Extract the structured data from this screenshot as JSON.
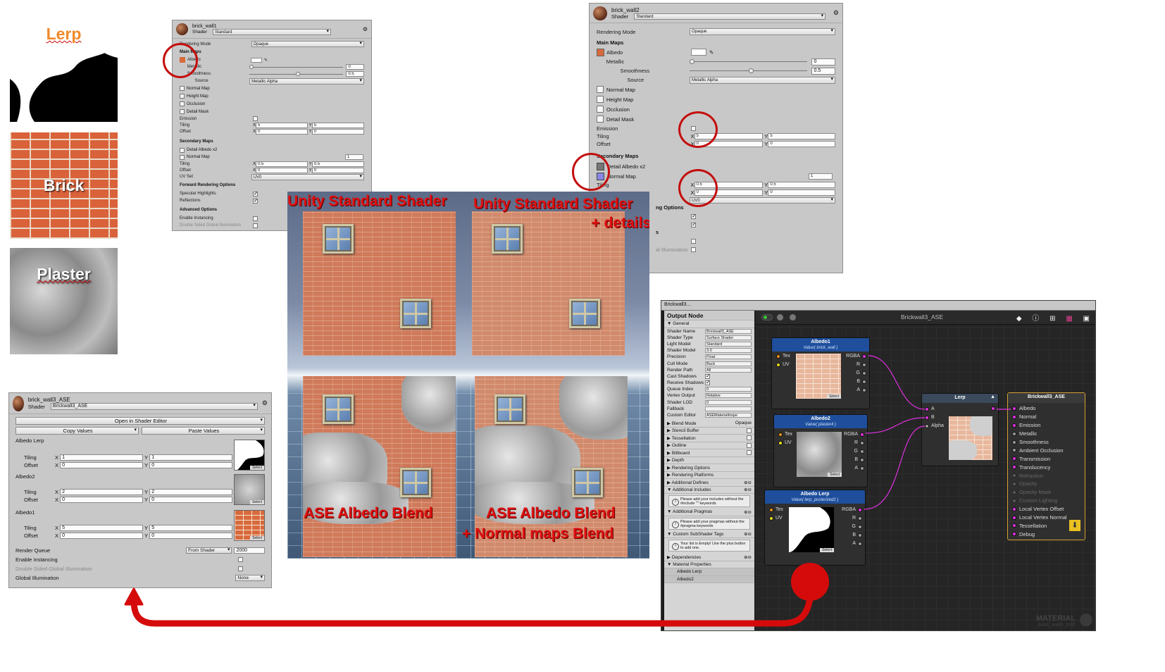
{
  "swatches": {
    "lerp": "Lerp",
    "brick": "Brick",
    "plaster": "Plaster"
  },
  "inspector1": {
    "material": "brick_wall1",
    "shader_label": "Shader",
    "shader": "Standard",
    "rendering_mode_label": "Rendering Mode",
    "rendering_mode": "Opaque",
    "main_maps": "Main Maps",
    "albedo": "Albedo",
    "metallic": "Metallic",
    "metallic_value": "0",
    "smoothness": "Smoothness",
    "smoothness_value": "0.5",
    "source": "Source",
    "source_value": "Metallic Alpha",
    "normal_map": "Normal Map",
    "height_map": "Height Map",
    "occlusion": "Occlusion",
    "detail_mask": "Detail Mask",
    "emission": "Emission",
    "tiling": "Tiling",
    "offset": "Offset",
    "tiling_x": "5",
    "tiling_y": "5",
    "offset_x": "0",
    "offset_y": "0",
    "secondary_maps": "Secondary Maps",
    "detail_albedo": "Detail Albedo x2",
    "normal_map2": "Normal Map",
    "normal_scale": "1",
    "tiling2_x": "0.5",
    "tiling2_y": "0.5",
    "offset2_x": "0",
    "offset2_y": "0",
    "uv_set": "UV Set",
    "uv_value": "UV0",
    "forward": "Forward Rendering Options",
    "specular": "Specular Highlights",
    "reflections": "Reflections",
    "advanced": "Advanced Options",
    "instancing": "Enable Instancing",
    "double_sided": "Double Sided Global Illumination"
  },
  "inspector2": {
    "material": "brick_wall2",
    "shader_label": "Shader",
    "shader": "Standard",
    "rendering_mode_label": "Rendering Mode",
    "rendering_mode": "Opaque",
    "main_maps": "Main Maps",
    "albedo": "Albedo",
    "metallic": "Metallic",
    "metallic_value": "0",
    "smoothness": "Smoothness",
    "smoothness_value": "0.5",
    "source": "Source",
    "source_value": "Metallic Alpha",
    "normal_map": "Normal Map",
    "height_map": "Height Map",
    "occlusion": "Occlusion",
    "detail_mask": "Detail Mask",
    "emission": "Emission",
    "tiling": "Tiling",
    "offset": "Offset",
    "tiling_x": "5",
    "tiling_y": "5",
    "offset_x": "0",
    "offset_y": "0",
    "secondary_maps": "Secondary Maps",
    "detail_albedo": "Detail Albedo x2",
    "normal_map2": "Normal Map",
    "normal_scale": "1",
    "tiling2": "Tiling",
    "tiling2_x": "0.5",
    "tiling2_y": "0.5",
    "offset2_x": "0",
    "offset2_y": "0",
    "uv_value": "UV0",
    "options_partial": "ng Options",
    "s_partial": "s",
    "gi_partial": "al Illumination"
  },
  "inspector3": {
    "material": "brick_wall3_ASE",
    "shader_label": "Shader",
    "shader": "Brickwall3_ASE",
    "open_editor": "Open in Shader Editor",
    "copy_values": "Copy Values",
    "paste_values": "Paste Values",
    "props": [
      {
        "name": "Albedo Lerp",
        "tx": "1",
        "ty": "1",
        "ox": "0",
        "oy": "0"
      },
      {
        "name": "Albedo2",
        "tx": "2",
        "ty": "2",
        "ox": "0",
        "oy": "0"
      },
      {
        "name": "Albedo1",
        "tx": "5",
        "ty": "5",
        "ox": "0",
        "oy": "0"
      }
    ],
    "tiling": "Tiling",
    "offset": "Offset",
    "select": "Select",
    "render_queue": "Render Queue",
    "render_queue_mode": "From Shader",
    "render_queue_value": "2000",
    "instancing": "Enable Instancing",
    "double_sided": "Double Sided Global Illumination",
    "global_illumination": "Global Illumination",
    "gi_value": "None"
  },
  "viewport": {
    "label_tl": "Unity Standard Shader",
    "label_tr1": "Unity Standard Shader",
    "label_tr2": "+ details",
    "label_bl": "ASE Albedo Blend",
    "label_br1": "ASE Albedo Blend",
    "label_br2": "+ Normal maps Blend"
  },
  "ase": {
    "tab": "Brickwall3...",
    "title": "Brickwall3_ASE",
    "output_node": "Output Node",
    "general": "General",
    "fields": [
      {
        "k": "Shader Name",
        "v": "Brickwall3_ASE"
      },
      {
        "k": "Shader Type",
        "v": "Surface Shader"
      },
      {
        "k": "Light Model",
        "v": "Standard"
      },
      {
        "k": "Shader Model",
        "v": "3.0"
      },
      {
        "k": "Precision",
        "v": "Float"
      },
      {
        "k": "Cull Mode",
        "v": "Back"
      },
      {
        "k": "Render Path",
        "v": "All"
      }
    ],
    "cast_shadows": "Cast Shadows",
    "receive_shadows": "Receive Shadows",
    "fields2": [
      {
        "k": "Queue Index",
        "v": "0"
      },
      {
        "k": "Vertex Output",
        "v": "Relative"
      },
      {
        "k": "Shader LOD",
        "v": "0"
      },
      {
        "k": "Fallback",
        "v": ""
      },
      {
        "k": "Custom Editor",
        "v": "ASEMaterialInspe"
      }
    ],
    "blend_mode": "Blend Mode",
    "blend_value": "Opaque",
    "sections": [
      "Stencil Buffer",
      "Tessellation",
      "Outline",
      "Billboard",
      "Depth",
      "Rendering Options",
      "Rendering Platforms",
      "Additional Defines",
      "Additional Includes"
    ],
    "includes_info": "Please add your includes without the #include \"\" keywords",
    "pragmas": "Additional Pragmas",
    "pragmas_info": "Please add your pragmas without the #pragma keywords",
    "subshader": "Custom SubShader Tags",
    "subshader_info": "Your list is Empty! Use the plus button to add one.",
    "dependencies": "Dependencies",
    "material_properties": "Material Properties",
    "mp_items": [
      "Albedo Lerp",
      "Albedo2"
    ],
    "node1": {
      "title": "Albedo1",
      "sub": "Value( brick_wall )"
    },
    "node2": {
      "title": "Albedo2",
      "sub": "Value( plaster4 )"
    },
    "node3": {
      "title": "Albedo Lerp",
      "sub": "Value( lerp_posterized2 )"
    },
    "tex": "Tex",
    "uv": "UV",
    "rgba": "RGBA",
    "r": "R",
    "g": "G",
    "b": "B",
    "a": "A",
    "lerp": {
      "title": "Lerp",
      "a": "A",
      "b": "B",
      "alpha": "Alpha"
    },
    "master": {
      "title": "Brickwall3_ASE",
      "inputs": [
        "Albedo",
        "Normal",
        "Emission",
        "Metallic",
        "Smoothness",
        "Ambient Occlusion",
        "Transmission",
        "Translucency",
        "Refraction",
        "Opacity",
        "Opacity Mask",
        "Custom Lighting",
        "Local Vertex Offset",
        "Local Vertex Normal",
        "Tessellation",
        "Debug"
      ]
    },
    "watermark1": "MATERIAL",
    "watermark2": "brick_wall3_ASE",
    "select": "Select"
  },
  "colors": {
    "annotation_red": "#c40d0d",
    "arrow_red": "#d50b0b",
    "node_blue": "#1f4f9c",
    "wire_magenta": "#e030e0",
    "master_gold": "#d4a030"
  }
}
